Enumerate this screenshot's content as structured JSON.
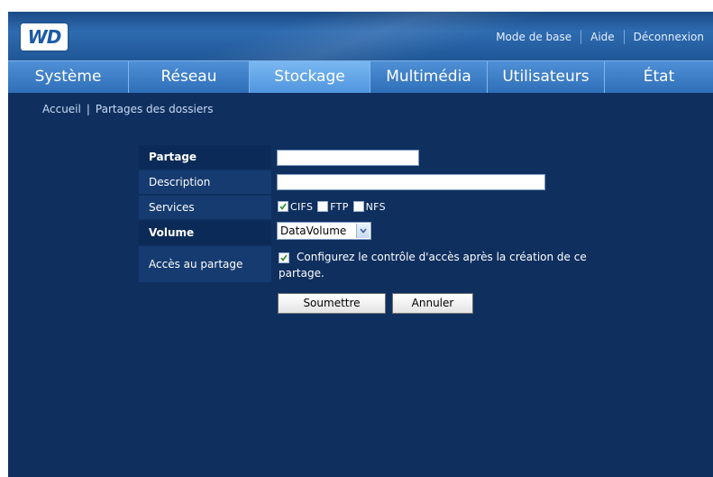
{
  "header": {
    "logo_text": "WD",
    "links": {
      "basic_mode": "Mode de base",
      "help": "Aide",
      "logout": "Déconnexion"
    }
  },
  "tabs": [
    {
      "label": "Système",
      "active": false
    },
    {
      "label": "Réseau",
      "active": false
    },
    {
      "label": "Stockage",
      "active": true
    },
    {
      "label": "Multimédia",
      "active": false
    },
    {
      "label": "Utilisateurs",
      "active": false
    },
    {
      "label": "État",
      "active": false
    }
  ],
  "breadcrumb": {
    "home": "Accueil",
    "separator": "|",
    "current": "Partages des dossiers"
  },
  "form": {
    "share_label": "Partage",
    "share_value": "",
    "description_label": "Description",
    "description_value": "",
    "services_label": "Services",
    "services": [
      {
        "label": "CIFS",
        "checked": true
      },
      {
        "label": "FTP",
        "checked": false
      },
      {
        "label": "NFS",
        "checked": false
      }
    ],
    "volume_label": "Volume",
    "volume_value": "DataVolume",
    "access_label": "Accès au partage",
    "access_checked": true,
    "access_text": "Configurez le contrôle d'accès après la création de ce partage.",
    "submit_label": "Soumettre",
    "cancel_label": "Annuler"
  },
  "colors": {
    "background": "#0f2f5f",
    "tab_bar": "#3f7fc6",
    "tab_active": "#6aaaf0",
    "label_cell": "#163b70",
    "header": "#2e6bb0"
  }
}
